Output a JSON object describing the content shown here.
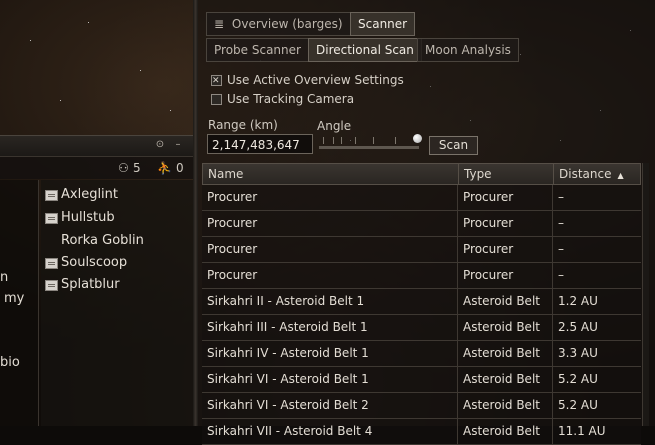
{
  "chat": {
    "counts": {
      "pilots": "5",
      "other": "0"
    },
    "body_lines": [
      "n",
      "my",
      "bio"
    ],
    "members": [
      "Axleglint",
      "Hullstub",
      "Rorka Goblin",
      "Soulscoop",
      "Splatblur"
    ]
  },
  "scanner": {
    "top_tabs": [
      "Overview (barges)",
      "Scanner"
    ],
    "sub_tabs": [
      "Probe Scanner",
      "Directional Scan",
      "Moon Analysis"
    ],
    "options": [
      {
        "label": "Use Active Overview Settings",
        "checked": true
      },
      {
        "label": "Use Tracking Camera",
        "checked": false
      }
    ],
    "range_label": "Range (km)",
    "angle_label": "Angle",
    "range_value": "2,147,483,647",
    "scan_label": "Scan",
    "columns": [
      "Name",
      "Type",
      "Distance"
    ],
    "rows": [
      [
        "Procurer",
        "Procurer",
        "–"
      ],
      [
        "Procurer",
        "Procurer",
        "–"
      ],
      [
        "Procurer",
        "Procurer",
        "–"
      ],
      [
        "Procurer",
        "Procurer",
        "–"
      ],
      [
        "Sirkahri II - Asteroid Belt 1",
        "Asteroid Belt",
        "1.2 AU"
      ],
      [
        "Sirkahri III - Asteroid Belt 1",
        "Asteroid Belt",
        "2.5 AU"
      ],
      [
        "Sirkahri IV - Asteroid Belt 1",
        "Asteroid Belt",
        "3.3 AU"
      ],
      [
        "Sirkahri VI - Asteroid Belt 1",
        "Asteroid Belt",
        "5.2 AU"
      ],
      [
        "Sirkahri VI - Asteroid Belt 2",
        "Asteroid Belt",
        "5.2 AU"
      ],
      [
        "Sirkahri VII - Asteroid Belt 4",
        "Asteroid Belt",
        "11.1 AU"
      ]
    ]
  },
  "icons": {
    "list": "list-icon",
    "settings": "settings-icon",
    "minimize": "minimize-icon",
    "pilot": "pilot-icon",
    "drone": "drone-icon",
    "member": "member-icon",
    "sort": "sort-ascending-icon"
  }
}
